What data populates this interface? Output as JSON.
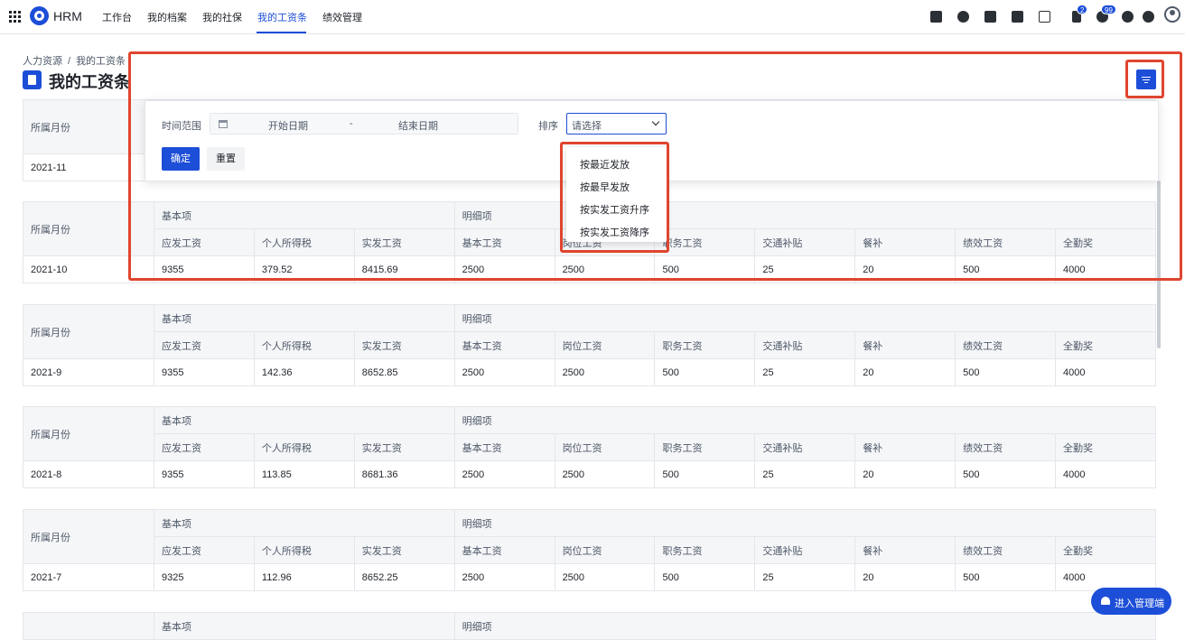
{
  "topbar": {
    "brand": "HRM",
    "nav": [
      "工作台",
      "我的档案",
      "我的社保",
      "我的工资条",
      "绩效管理"
    ],
    "active_nav": "我的工资条",
    "badges": {
      "flag": "2",
      "bell": "99"
    }
  },
  "breadcrumb": [
    "人力资源",
    "/",
    "我的工资条"
  ],
  "page_title": "我的工资条",
  "filter": {
    "time_label": "时间范围",
    "start_placeholder": "开始日期",
    "separator": "-",
    "end_placeholder": "结束日期",
    "sort_label": "排序",
    "sort_placeholder": "请选择",
    "confirm_label": "确定",
    "reset_label": "重置",
    "sort_options": [
      "按最近发放",
      "按最早发放",
      "按实发工资升序",
      "按实发工资降序"
    ]
  },
  "table_headers": {
    "month": "所属月份",
    "group_basic": "基本项",
    "group_detail": "明细项",
    "columns": [
      "应发工资",
      "个人所得税",
      "实发工资",
      "基本工资",
      "岗位工资",
      "职务工资",
      "交通补贴",
      "餐补",
      "绩效工资",
      "全勤奖"
    ]
  },
  "records": [
    {
      "month": "2021-11",
      "values": [
        "",
        "",
        "",
        "",
        "",
        "",
        "",
        "",
        "",
        ""
      ]
    },
    {
      "month": "2021-10",
      "values": [
        "9355",
        "379.52",
        "8415.69",
        "2500",
        "2500",
        "500",
        "25",
        "20",
        "500",
        "4000"
      ]
    },
    {
      "month": "2021-9",
      "values": [
        "9355",
        "142.36",
        "8652.85",
        "2500",
        "2500",
        "500",
        "25",
        "20",
        "500",
        "4000"
      ]
    },
    {
      "month": "2021-8",
      "values": [
        "9355",
        "113.85",
        "8681.36",
        "2500",
        "2500",
        "500",
        "25",
        "20",
        "500",
        "4000"
      ]
    },
    {
      "month": "2021-7",
      "values": [
        "9325",
        "112.96",
        "8652.25",
        "2500",
        "2500",
        "500",
        "25",
        "20",
        "500",
        "4000"
      ]
    }
  ],
  "admin_button": "进入管理端",
  "colors": {
    "accent": "#1d4ed8",
    "highlight": "#e0452f"
  }
}
